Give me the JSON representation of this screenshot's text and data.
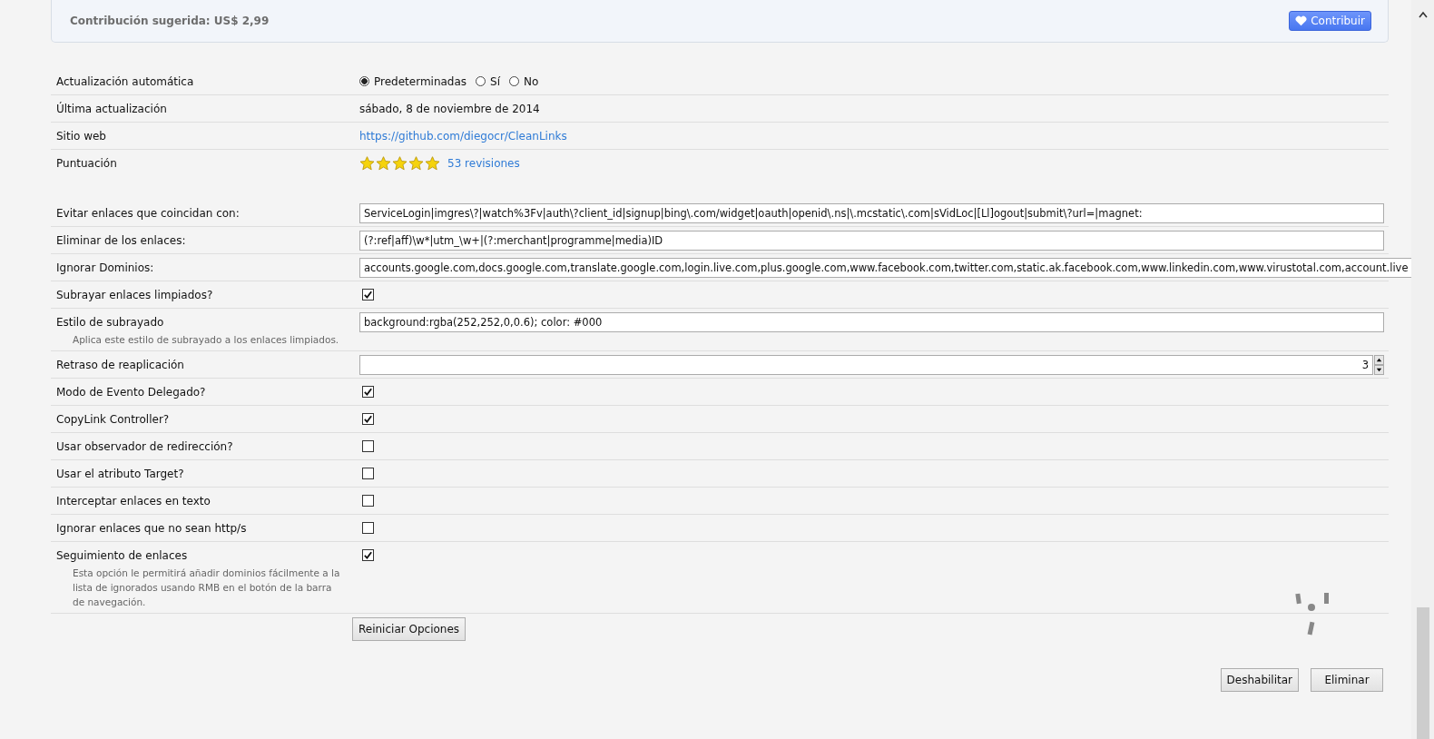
{
  "contribution": {
    "text": "Contribución sugerida: US$ 2,99",
    "button": "Contribuir"
  },
  "details": [
    {
      "kind": "radio",
      "label": "Actualización automática",
      "options": [
        {
          "label": "Predeterminadas",
          "selected": true
        },
        {
          "label": "Sí",
          "selected": false
        },
        {
          "label": "No",
          "selected": false
        }
      ]
    },
    {
      "kind": "text",
      "label": "Última actualización",
      "value": "sábado, 8 de noviembre de 2014"
    },
    {
      "kind": "link",
      "label": "Sitio web",
      "value": "https://github.com/diegocr/CleanLinks"
    },
    {
      "kind": "rating",
      "label": "Puntuación",
      "stars": 5,
      "link": "53 revisiones"
    }
  ],
  "preferences": [
    {
      "kind": "input",
      "label": "Evitar enlaces que coincidan con:",
      "value": "ServiceLogin|imgres\\?|watch%3Fv|auth\\?client_id|signup|bing\\.com/widget|oauth|openid\\.ns|\\.mcstatic\\.com|sVidLoc|[Ll]ogout|submit\\?url=|magnet:"
    },
    {
      "kind": "input",
      "label": "Eliminar de los enlaces:",
      "value": "(?:ref|aff)\\w*|utm_\\w+|(?:merchant|programme|media)ID"
    },
    {
      "kind": "input",
      "label": "Ignorar Dominios:",
      "value": "accounts.google.com,docs.google.com,translate.google.com,login.live.com,plus.google.com,www.facebook.com,twitter.com,static.ak.facebook.com,www.linkedin.com,www.virustotal.com,account.live"
    },
    {
      "kind": "checkbox",
      "label": "Subrayar enlaces limpiados?",
      "checked": true
    },
    {
      "kind": "input",
      "label": "Estilo de subrayado",
      "value": "background:rgba(252,252,0,0.6); color: #000",
      "description": "Aplica este estilo de subrayado a los enlaces limpiados."
    },
    {
      "kind": "number",
      "label": "Retraso de reaplicación",
      "value": "3"
    },
    {
      "kind": "checkbox",
      "label": "Modo de Evento Delegado?",
      "checked": true
    },
    {
      "kind": "checkbox",
      "label": "CopyLink Controller?",
      "checked": true
    },
    {
      "kind": "checkbox",
      "label": "Usar observador de redirección?",
      "checked": false
    },
    {
      "kind": "checkbox",
      "label": "Usar el atributo Target?",
      "checked": false
    },
    {
      "kind": "checkbox",
      "label": "Interceptar enlaces en texto",
      "checked": false
    },
    {
      "kind": "checkbox",
      "label": "Ignorar enlaces que no sean http/s",
      "checked": false
    },
    {
      "kind": "checkbox",
      "label": "Seguimiento de enlaces",
      "checked": true,
      "description": "Esta opción le permitirá añadir dominios fácilmente a la lista de ignorados usando RMB en el botón de la barra de navegación."
    }
  ],
  "reset_button": "Reiniciar Opciones",
  "buttons": [
    "Deshabilitar",
    "Eliminar"
  ]
}
